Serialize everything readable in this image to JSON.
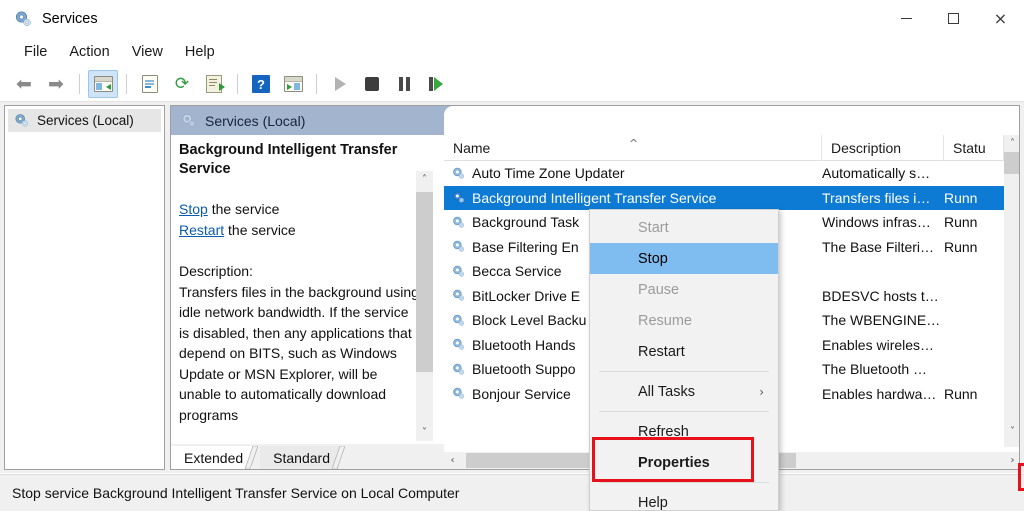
{
  "window": {
    "title": "Services",
    "icon": "services-gear-icon",
    "controls": {
      "minimize": "—",
      "maximize": "□",
      "close": "×"
    }
  },
  "menubar": {
    "items": [
      "File",
      "Action",
      "View",
      "Help"
    ]
  },
  "toolbar": {
    "buttons": [
      {
        "name": "back-button",
        "icon": "left-arrow-icon"
      },
      {
        "name": "forward-button",
        "icon": "right-arrow-icon"
      },
      {
        "name": "show-hide-console-tree-button",
        "icon": "console-tree-icon"
      },
      {
        "name": "properties-button",
        "icon": "properties-window-icon"
      },
      {
        "name": "refresh-button",
        "icon": "refresh-icon"
      },
      {
        "name": "export-list-button",
        "icon": "export-list-icon"
      },
      {
        "name": "help-button",
        "icon": "question-mark-icon"
      },
      {
        "name": "show-action-pane-button",
        "icon": "action-pane-icon"
      },
      {
        "name": "start-service-button",
        "icon": "play-icon"
      },
      {
        "name": "stop-service-button",
        "icon": "stop-icon"
      },
      {
        "name": "pause-service-button",
        "icon": "pause-icon"
      },
      {
        "name": "restart-service-button",
        "icon": "restart-icon"
      }
    ]
  },
  "tree": {
    "root_label": "Services (Local)",
    "root_icon": "services-gear-icon"
  },
  "pane_header": {
    "label": "Services (Local)",
    "icon": "services-gear-icon"
  },
  "detail": {
    "service_title": "Background Intelligent Transfer Service",
    "links": [
      {
        "link_text": "Stop",
        "suffix": " the service"
      },
      {
        "link_text": "Restart",
        "suffix": " the service"
      }
    ],
    "description_label": "Description:",
    "description_text": "Transfers files in the background using idle network bandwidth. If the service is disabled, then any applications that depend on BITS, such as Windows Update or MSN Explorer, will be unable to automatically download programs",
    "tabs": [
      {
        "label": "Extended",
        "active": true
      },
      {
        "label": "Standard",
        "active": false
      }
    ]
  },
  "list": {
    "columns": [
      "Name",
      "Description",
      "Statu"
    ],
    "sort_indicator": "^",
    "rows": [
      {
        "name": "Auto Time Zone Updater",
        "description": "Automatically s…",
        "status": "",
        "selected": false
      },
      {
        "name": "Background Intelligent Transfer Service",
        "description": "Transfers files i…",
        "status": "Runn",
        "selected": true
      },
      {
        "name": "Background Task",
        "description": "Windows infras…",
        "status": "Runn",
        "selected": false
      },
      {
        "name": "Base Filtering En",
        "description": "The Base Filteri…",
        "status": "Runn",
        "selected": false
      },
      {
        "name": "Becca Service",
        "description": "",
        "status": "",
        "selected": false
      },
      {
        "name": "BitLocker Drive E",
        "description": "BDESVC hosts t…",
        "status": "",
        "selected": false
      },
      {
        "name": "Block Level Backu",
        "description": "The WBENGINE…",
        "status": "",
        "selected": false
      },
      {
        "name": "Bluetooth Hands",
        "description": "Enables wireles…",
        "status": "",
        "selected": false
      },
      {
        "name": "Bluetooth Suppo",
        "description": "The Bluetooth …",
        "status": "",
        "selected": false
      },
      {
        "name": "Bonjour Service",
        "description": "Enables hardwa…",
        "status": "Runn",
        "selected": false
      }
    ],
    "scroll": {
      "up_arrow": "˄",
      "down_arrow": "˅",
      "left_arrow": "‹",
      "right_arrow": "›"
    }
  },
  "context_menu": {
    "items": [
      {
        "label": "Start",
        "state": "disabled"
      },
      {
        "label": "Stop",
        "state": "highlighted"
      },
      {
        "label": "Pause",
        "state": "disabled"
      },
      {
        "label": "Resume",
        "state": "disabled"
      },
      {
        "label": "Restart",
        "state": "normal"
      },
      {
        "separator": true
      },
      {
        "label": "All Tasks",
        "state": "normal",
        "submenu_arrow": "›"
      },
      {
        "separator": true
      },
      {
        "label": "Refresh",
        "state": "normal"
      },
      {
        "label": "Properties",
        "state": "bold"
      },
      {
        "separator": true
      },
      {
        "label": "Help",
        "state": "normal"
      }
    ]
  },
  "statusbar": {
    "text": "Stop service Background Intelligent Transfer Service on Local Computer"
  },
  "annotation": {
    "color": "#e8101a",
    "target": "Properties"
  },
  "colors": {
    "selection_blue": "#0d7bd4",
    "menu_highlight": "#7fbdf0",
    "pane_header": "#a3b5ce",
    "link_blue": "#0b5cab",
    "annotation_red": "#e8101a"
  }
}
